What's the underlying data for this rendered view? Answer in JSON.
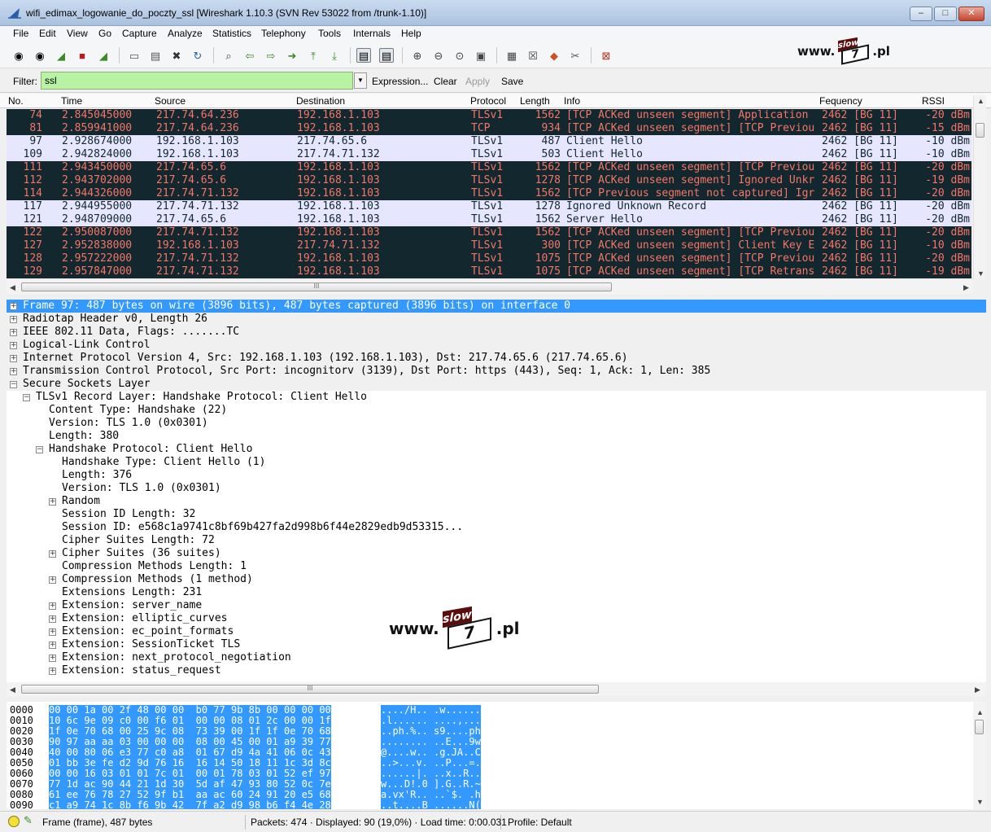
{
  "window": {
    "title": "wifi_edimax_logowanie_do_poczty_ssl  [Wireshark 1.10.3  (SVN Rev 53022 from /trunk-1.10)]",
    "min_label": "–",
    "max_label": "□",
    "close_label": "✕"
  },
  "menu": [
    "File",
    "Edit",
    "View",
    "Go",
    "Capture",
    "Analyze",
    "Statistics",
    "Telephony",
    "Tools",
    "Internals",
    "Help"
  ],
  "toolbar": {
    "icons": [
      "interfaces-icon",
      "options-icon",
      "start-capture-icon",
      "stop-capture-icon",
      "restart-capture-icon",
      "open-file-icon",
      "save-file-icon",
      "close-file-icon",
      "reload-icon",
      "find-icon",
      "back-icon",
      "forward-icon",
      "goto-packet-icon",
      "first-packet-icon",
      "last-packet-icon",
      "colorize-icon",
      "autoscroll-icon",
      "zoom-in-icon",
      "zoom-out-icon",
      "zoom-normal-icon",
      "resize-columns-icon",
      "capture-filters-icon",
      "display-filters-icon",
      "coloring-rules-icon",
      "preferences-icon",
      "help-icon"
    ]
  },
  "logo": {
    "prefix": "www.",
    "flag_top": "slow",
    "flag_bottom": "7",
    "suffix": ".pl"
  },
  "filter": {
    "label": "Filter:",
    "value": "ssl",
    "expression": "Expression...",
    "clear": "Clear",
    "apply": "Apply",
    "save": "Save"
  },
  "packet_list": {
    "columns": [
      "No.",
      "Time",
      "Source",
      "Destination",
      "Protocol",
      "Length",
      "Info",
      "Fequency",
      "RSSI"
    ],
    "rows": [
      {
        "no": "74",
        "time": "2.845045000",
        "src": "217.74.64.236",
        "dst": "192.168.1.103",
        "proto": "TLSv1",
        "len": "1562",
        "info": "[TCP ACKed unseen segment] Application",
        "freq": "2462 [BG 11]",
        "rssi": "-20 dBm",
        "bad": true
      },
      {
        "no": "81",
        "time": "2.859941000",
        "src": "217.74.64.236",
        "dst": "192.168.1.103",
        "proto": "TCP",
        "len": "934",
        "info": "[TCP ACKed unseen segment] [TCP Previou",
        "freq": "2462 [BG 11]",
        "rssi": "-15 dBm",
        "bad": true
      },
      {
        "no": "97",
        "time": "2.928674000",
        "src": "192.168.1.103",
        "dst": "217.74.65.6",
        "proto": "TLSv1",
        "len": "487",
        "info": "Client Hello",
        "freq": "2462 [BG 11]",
        "rssi": "-10 dBm",
        "bad": false
      },
      {
        "no": "109",
        "time": "2.942824000",
        "src": "192.168.1.103",
        "dst": "217.74.71.132",
        "proto": "TLSv1",
        "len": "503",
        "info": "Client Hello",
        "freq": "2462 [BG 11]",
        "rssi": "-10 dBm",
        "bad": false
      },
      {
        "no": "111",
        "time": "2.943450000",
        "src": "217.74.65.6",
        "dst": "192.168.1.103",
        "proto": "TLSv1",
        "len": "1562",
        "info": "[TCP ACKed unseen segment] [TCP Previou",
        "freq": "2462 [BG 11]",
        "rssi": "-20 dBm",
        "bad": true
      },
      {
        "no": "112",
        "time": "2.943702000",
        "src": "217.74.65.6",
        "dst": "192.168.1.103",
        "proto": "TLSv1",
        "len": "1278",
        "info": "[TCP ACKed unseen segment] Ignored Unkr",
        "freq": "2462 [BG 11]",
        "rssi": "-19 dBm",
        "bad": true
      },
      {
        "no": "114",
        "time": "2.944326000",
        "src": "217.74.71.132",
        "dst": "192.168.1.103",
        "proto": "TLSv1",
        "len": "1562",
        "info": "[TCP Previous segment not captured] Igr",
        "freq": "2462 [BG 11]",
        "rssi": "-20 dBm",
        "bad": true
      },
      {
        "no": "117",
        "time": "2.944955000",
        "src": "217.74.71.132",
        "dst": "192.168.1.103",
        "proto": "TLSv1",
        "len": "1278",
        "info": "Ignored Unknown Record",
        "freq": "2462 [BG 11]",
        "rssi": "-20 dBm",
        "bad": false
      },
      {
        "no": "121",
        "time": "2.948709000",
        "src": "217.74.65.6",
        "dst": "192.168.1.103",
        "proto": "TLSv1",
        "len": "1562",
        "info": "Server Hello",
        "freq": "2462 [BG 11]",
        "rssi": "-20 dBm",
        "bad": false
      },
      {
        "no": "122",
        "time": "2.950087000",
        "src": "217.74.71.132",
        "dst": "192.168.1.103",
        "proto": "TLSv1",
        "len": "1562",
        "info": "[TCP ACKed unseen segment] [TCP Previou",
        "freq": "2462 [BG 11]",
        "rssi": "-20 dBm",
        "bad": true
      },
      {
        "no": "127",
        "time": "2.952838000",
        "src": "192.168.1.103",
        "dst": "217.74.71.132",
        "proto": "TLSv1",
        "len": "300",
        "info": "[TCP ACKed unseen segment] Client Key E",
        "freq": "2462 [BG 11]",
        "rssi": "-10 dBm",
        "bad": true
      },
      {
        "no": "128",
        "time": "2.957222000",
        "src": "217.74.71.132",
        "dst": "192.168.1.103",
        "proto": "TLSv1",
        "len": "1075",
        "info": "[TCP ACKed unseen segment] [TCP Previou",
        "freq": "2462 [BG 11]",
        "rssi": "-20 dBm",
        "bad": true
      },
      {
        "no": "129",
        "time": "2.957847000",
        "src": "217.74.71.132",
        "dst": "192.168.1.103",
        "proto": "TLSv1",
        "len": "1075",
        "info": "[TCP ACKed unseen segment] [TCP Retrans",
        "freq": "2462 [BG 11]",
        "rssi": "-19 dBm",
        "bad": true
      }
    ],
    "hscroll_grip": "III"
  },
  "details": {
    "rows": [
      {
        "level": 0,
        "exp": "+",
        "text": "Frame 97: 487 bytes on wire (3896 bits), 487 bytes captured (3896 bits) on interface 0",
        "selected": true
      },
      {
        "level": 0,
        "exp": "+",
        "text": "Radiotap Header v0, Length 26"
      },
      {
        "level": 0,
        "exp": "+",
        "text": "IEEE 802.11 Data, Flags: .......TC"
      },
      {
        "level": 0,
        "exp": "+",
        "text": "Logical-Link Control"
      },
      {
        "level": 0,
        "exp": "+",
        "text": "Internet Protocol Version 4, Src: 192.168.1.103 (192.168.1.103), Dst: 217.74.65.6 (217.74.65.6)"
      },
      {
        "level": 0,
        "exp": "+",
        "text": "Transmission Control Protocol, Src Port: incognitorv (3139), Dst Port: https (443), Seq: 1, Ack: 1, Len: 385"
      },
      {
        "level": 0,
        "exp": "−",
        "text": "Secure Sockets Layer"
      },
      {
        "level": 1,
        "exp": "−",
        "text": "TLSv1 Record Layer: Handshake Protocol: Client Hello"
      },
      {
        "level": 2,
        "exp": "",
        "text": "Content Type: Handshake (22)"
      },
      {
        "level": 2,
        "exp": "",
        "text": "Version: TLS 1.0 (0x0301)"
      },
      {
        "level": 2,
        "exp": "",
        "text": "Length: 380"
      },
      {
        "level": 2,
        "exp": "−",
        "text": "Handshake Protocol: Client Hello"
      },
      {
        "level": 3,
        "exp": "",
        "text": "Handshake Type: Client Hello (1)"
      },
      {
        "level": 3,
        "exp": "",
        "text": "Length: 376"
      },
      {
        "level": 3,
        "exp": "",
        "text": "Version: TLS 1.0 (0x0301)"
      },
      {
        "level": 3,
        "exp": "+",
        "text": "Random"
      },
      {
        "level": 3,
        "exp": "",
        "text": "Session ID Length: 32"
      },
      {
        "level": 3,
        "exp": "",
        "text": "Session ID: e568c1a9741c8bf69b427fa2d998b6f44e2829edb9d53315..."
      },
      {
        "level": 3,
        "exp": "",
        "text": "Cipher Suites Length: 72"
      },
      {
        "level": 3,
        "exp": "+",
        "text": "Cipher Suites (36 suites)"
      },
      {
        "level": 3,
        "exp": "",
        "text": "Compression Methods Length: 1"
      },
      {
        "level": 3,
        "exp": "+",
        "text": "Compression Methods (1 method)"
      },
      {
        "level": 3,
        "exp": "",
        "text": "Extensions Length: 231"
      },
      {
        "level": 3,
        "exp": "+",
        "text": "Extension: server_name"
      },
      {
        "level": 3,
        "exp": "+",
        "text": "Extension: elliptic_curves"
      },
      {
        "level": 3,
        "exp": "+",
        "text": "Extension: ec_point_formats"
      },
      {
        "level": 3,
        "exp": "+",
        "text": "Extension: SessionTicket TLS"
      },
      {
        "level": 3,
        "exp": "+",
        "text": "Extension: next_protocol_negotiation"
      },
      {
        "level": 3,
        "exp": "+",
        "text": "Extension: status_request"
      }
    ],
    "hscroll_grip": "III"
  },
  "bytes": {
    "rows": [
      {
        "off": "0000",
        "hex": "00 00 1a 00 2f 48 00 00  b0 77 9b 8b 00 00 00 00",
        "ascii": "..../H.. .w......"
      },
      {
        "off": "0010",
        "hex": "10 6c 9e 09 c0 00 f6 01  00 00 08 01 2c 00 00 1f",
        "ascii": ".l...... ....,..."
      },
      {
        "off": "0020",
        "hex": "1f 0e 70 68 00 25 9c 08  73 39 00 1f 1f 0e 70 68",
        "ascii": "..ph.%.. s9....ph"
      },
      {
        "off": "0030",
        "hex": "90 97 aa aa 03 00 00 00  08 00 45 00 01 a9 39 77",
        "ascii": "........ ..E...9w"
      },
      {
        "off": "0040",
        "hex": "40 00 80 06 e3 77 c0 a8  01 67 d9 4a 41 06 0c 43",
        "ascii": "@....w.. .g.JA..C"
      },
      {
        "off": "0050",
        "hex": "01 bb 3e fe d2 9d 76 16  16 14 50 18 11 1c 3d 8c",
        "ascii": "..>...v. ..P...=."
      },
      {
        "off": "0060",
        "hex": "00 00 16 03 01 01 7c 01  00 01 78 03 01 52 ef 97",
        "ascii": "......|. ..x..R.."
      },
      {
        "off": "0070",
        "hex": "77 1d ac 90 44 21 1d 30  5d af 47 93 80 52 0c 7e",
        "ascii": "w...D!.0 ].G..R.~"
      },
      {
        "off": "0080",
        "hex": "61 ee 76 78 27 52 9f b1  aa ac 60 24 91 20 e5 68",
        "ascii": "a.vx'R.. ..`$. .h"
      },
      {
        "off": "0090",
        "hex": "c1 a9 74 1c 8b f6 9b 42  7f a2 d9 98 b6 f4 4e 28",
        "ascii": "..t....B ......N("
      }
    ]
  },
  "statusbar": {
    "field": "Frame (frame), 487 bytes",
    "packets": "Packets: 474 · Displayed: 90 (19,0%)  · Load time: 0:00.031",
    "profile": "Profile: Default"
  },
  "colors": {
    "bad_bg": "#12272e",
    "bad_fg": "#f77564",
    "ok_bg": "#e7e6ff",
    "selection": "#3399ff",
    "filter_ok": "#b7f3a3"
  }
}
